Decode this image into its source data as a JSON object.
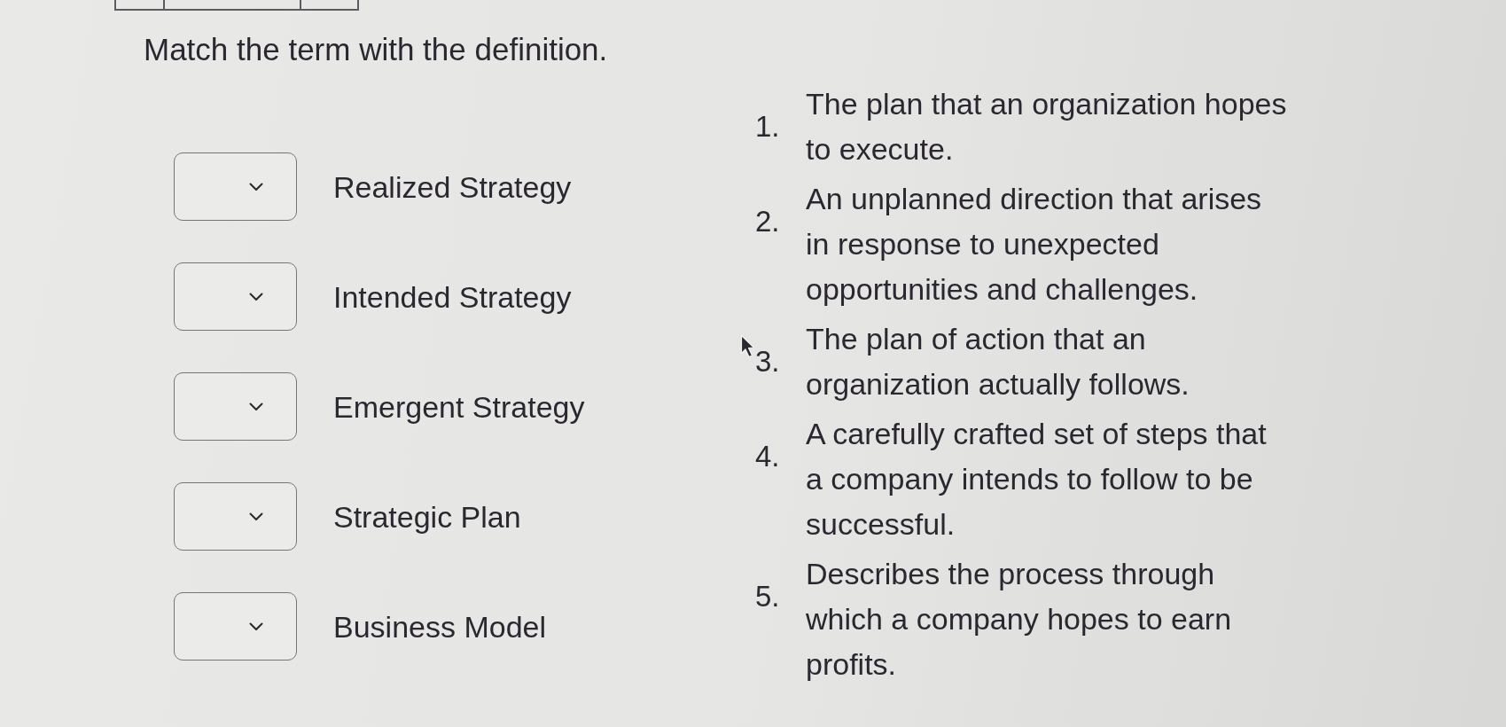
{
  "page": {
    "title": "Match the term with the definition."
  },
  "terms": [
    {
      "label": "Realized Strategy"
    },
    {
      "label": "Intended Strategy"
    },
    {
      "label": "Emergent Strategy"
    },
    {
      "label": "Strategic Plan"
    },
    {
      "label": "Business Model"
    }
  ],
  "definitions": [
    {
      "number": "1.",
      "lines": [
        "The plan that an organization hopes",
        "to execute."
      ],
      "hovered": false
    },
    {
      "number": "2.",
      "lines": [
        "An unplanned direction that arises",
        "in response to unexpected",
        "opportunities and challenges."
      ],
      "hovered": false
    },
    {
      "number": "3.",
      "lines": [
        "The plan of action that an",
        "organization actually follows."
      ],
      "hovered": true
    },
    {
      "number": "4.",
      "lines": [
        "A carefully crafted set of steps that",
        "a company intends to follow to be",
        "successful."
      ],
      "hovered": false
    },
    {
      "number": "5.",
      "lines": [
        "Describes the process through",
        "which a company hopes to earn",
        "profits."
      ],
      "hovered": false
    }
  ]
}
